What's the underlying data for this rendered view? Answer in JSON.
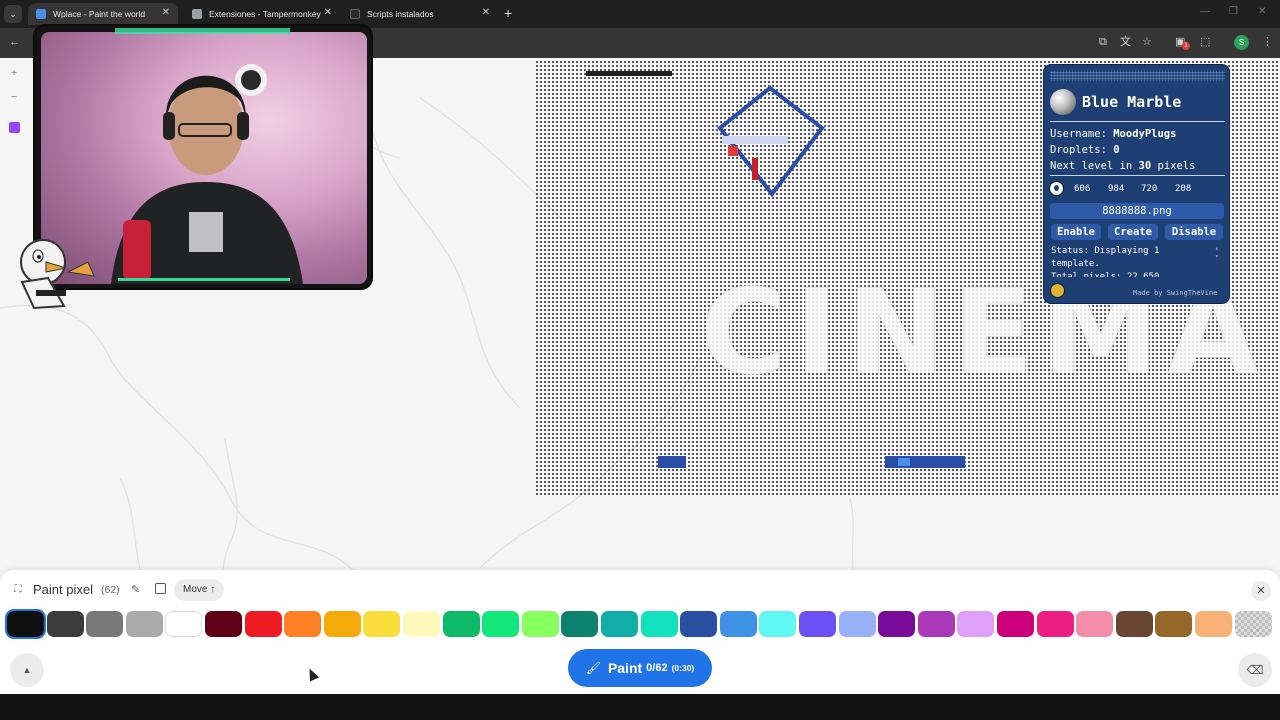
{
  "browser": {
    "tabs": [
      {
        "label": "Wplace - Paint the world",
        "active": true,
        "favicon_color": "#4a8fe8"
      },
      {
        "label": "Extensiones - Tampermonkey",
        "active": false,
        "favicon_color": "#9aa0a6"
      },
      {
        "label": "Scripts instalados",
        "active": false,
        "favicon_color": "#2a2a2a"
      }
    ],
    "new_tab": "+",
    "profile_initial": "S",
    "extension_badge": "1"
  },
  "blue_marble": {
    "title": "Blue Marble",
    "username_label": "Username:",
    "username": "MoodyPlugs",
    "droplets_label": "Droplets:",
    "droplets": "0",
    "next_level_prefix": "Next level in",
    "next_level_value": "30",
    "next_level_suffix": "pixels",
    "coords": [
      "606",
      "984",
      "720",
      "208"
    ],
    "file": "8888888.png",
    "buttons": {
      "enable": "Enable",
      "create": "Create",
      "disable": "Disable"
    },
    "status_text": "Status: Displaying 1 template.\nTotal pixels: 22,650",
    "made_by": "Made by SwingTheVine",
    "colors": {
      "panel": "#1e3f73",
      "button": "#2e5aa8"
    }
  },
  "panel": {
    "title": "Paint pixel",
    "count": "(62)",
    "move_label": "Move",
    "paint_label": "Paint",
    "paint_count": "0/62",
    "paint_timer": "(0:30)",
    "accent": "#2174e8"
  },
  "palette": [
    "#0f0f0f",
    "#3c3c3c",
    "#787878",
    "#aaaaaa",
    "#ffffff",
    "#600018",
    "#ed1c24",
    "#ff7f27",
    "#f6aa09",
    "#f9dd3b",
    "#fffabc",
    "#0eb968",
    "#13e67b",
    "#87ff5e",
    "#0c816e",
    "#10aea6",
    "#13e1be",
    "#28509e",
    "#4093e4",
    "#60f7f2",
    "#6b50f6",
    "#99b1fb",
    "#780c99",
    "#aa38b9",
    "#e09ff9",
    "#cb007a",
    "#ec1f80",
    "#f38da9",
    "#684634",
    "#95682a",
    "#f8b277",
    "transparent"
  ],
  "selected_color_index": 0
}
